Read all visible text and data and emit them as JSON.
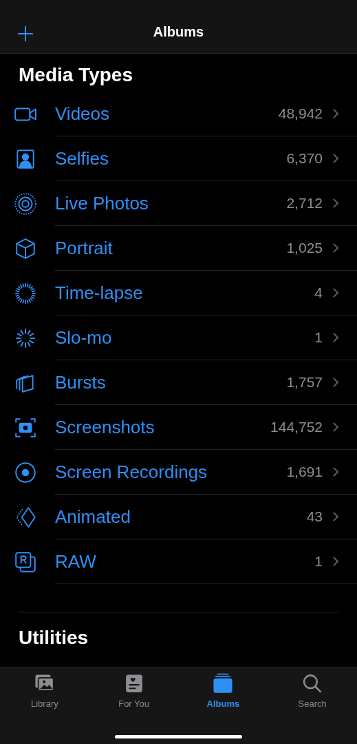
{
  "nav_bar": {
    "title": "Albums"
  },
  "sections": [
    {
      "title": "Media Types",
      "items": [
        {
          "kind": "video",
          "label": "Videos",
          "count": "48,942"
        },
        {
          "kind": "selfie",
          "label": "Selfies",
          "count": "6,370"
        },
        {
          "kind": "live",
          "label": "Live Photos",
          "count": "2,712"
        },
        {
          "kind": "portrait",
          "label": "Portrait",
          "count": "1,025"
        },
        {
          "kind": "timelapse",
          "label": "Time-lapse",
          "count": "4"
        },
        {
          "kind": "slomo",
          "label": "Slo-mo",
          "count": "1"
        },
        {
          "kind": "bursts",
          "label": "Bursts",
          "count": "1,757"
        },
        {
          "kind": "screenshot",
          "label": "Screenshots",
          "count": "144,752"
        },
        {
          "kind": "recording",
          "label": "Screen Recordings",
          "count": "1,691"
        },
        {
          "kind": "animated",
          "label": "Animated",
          "count": "43"
        },
        {
          "kind": "raw",
          "label": "RAW",
          "count": "1"
        }
      ]
    },
    {
      "title": "Utilities"
    }
  ],
  "tab_bar": [
    {
      "kind": "library",
      "label": "Library",
      "selected": false
    },
    {
      "kind": "foryou",
      "label": "For You",
      "selected": false
    },
    {
      "kind": "albums",
      "label": "Albums",
      "selected": true
    },
    {
      "kind": "search",
      "label": "Search",
      "selected": false
    }
  ]
}
